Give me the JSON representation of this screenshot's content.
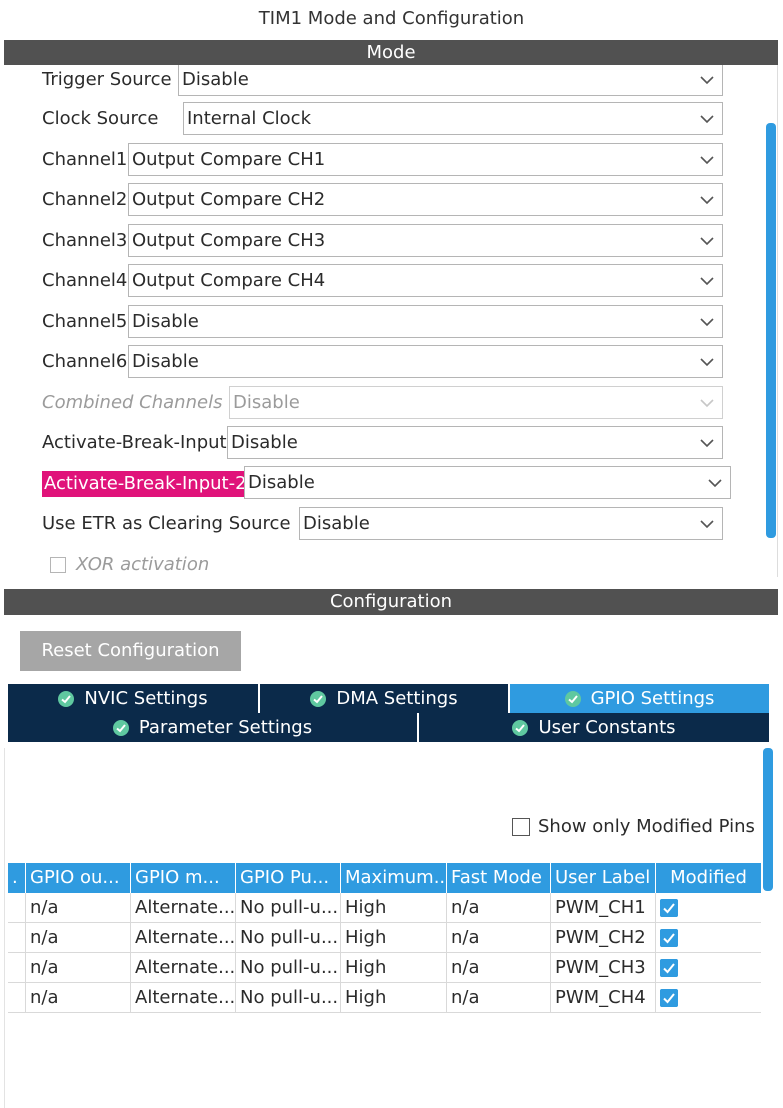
{
  "window": {
    "title": "TIM1 Mode and Configuration"
  },
  "mode": {
    "header": "Mode",
    "rows": [
      {
        "label": "Trigger Source",
        "value": "Disable"
      },
      {
        "label": "Clock Source",
        "value": "Internal Clock"
      },
      {
        "label": "Channel1",
        "value": "Output Compare CH1"
      },
      {
        "label": "Channel2",
        "value": "Output Compare CH2"
      },
      {
        "label": "Channel3",
        "value": "Output Compare CH3"
      },
      {
        "label": "Channel4",
        "value": "Output Compare CH4"
      },
      {
        "label": "Channel5",
        "value": "Disable"
      },
      {
        "label": "Channel6",
        "value": "Disable"
      },
      {
        "label": "Combined Channels",
        "value": "Disable"
      },
      {
        "label": "Activate-Break-Input",
        "value": "Disable"
      },
      {
        "label": "Activate-Break-Input-2",
        "value": "Disable"
      },
      {
        "label": "Use ETR as Clearing Source",
        "value": "Disable"
      }
    ],
    "xor": {
      "label": "XOR activation"
    }
  },
  "configuration": {
    "header": "Configuration",
    "reset_label": "Reset Configuration",
    "tabs_row1": [
      {
        "label": "NVIC Settings"
      },
      {
        "label": "DMA Settings"
      },
      {
        "label": "GPIO Settings"
      }
    ],
    "tabs_row2": [
      {
        "label": "Parameter Settings"
      },
      {
        "label": "User Constants"
      }
    ],
    "show_modified_label": "Show only Modified Pins",
    "table": {
      "headers": [
        ".",
        "GPIO ou...",
        "GPIO m...",
        "GPIO Pu...",
        "Maximum...",
        "Fast Mode",
        "User Label",
        "Modified"
      ],
      "rows": [
        [
          "",
          "n/a",
          "Alternate...",
          "No pull-u...",
          "High",
          "n/a",
          "PWM_CH1",
          ""
        ],
        [
          "",
          "n/a",
          "Alternate...",
          "No pull-u...",
          "High",
          "n/a",
          "PWM_CH2",
          ""
        ],
        [
          "",
          "n/a",
          "Alternate...",
          "No pull-u...",
          "High",
          "n/a",
          "PWM_CH3",
          ""
        ],
        [
          "",
          "n/a",
          "Alternate...",
          "No pull-u...",
          "High",
          "n/a",
          "PWM_CH4",
          ""
        ]
      ]
    }
  },
  "colors": {
    "accent": "#2f9be0",
    "navy": "#0b2a4a",
    "highlight": "#e0137a",
    "bar": "#515151"
  }
}
